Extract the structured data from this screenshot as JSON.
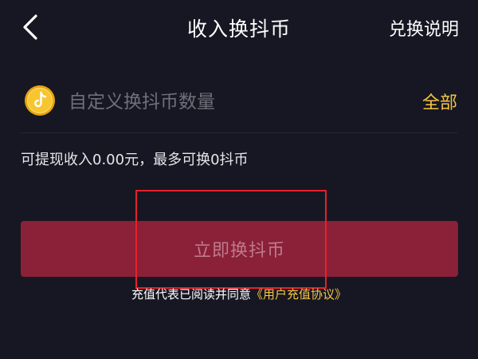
{
  "header": {
    "title": "收入换抖币",
    "explain_label": "兑换说明"
  },
  "amount": {
    "placeholder": "自定义换抖币数量",
    "value": "",
    "all_label": "全部"
  },
  "info": {
    "text": "可提现收入0.00元，最多可换0抖币"
  },
  "exchange_button": {
    "label": "立即换抖币"
  },
  "agreement": {
    "prefix": "充值代表已阅读并同意",
    "link": "《用户充值协议》"
  },
  "colors": {
    "background": "#161722",
    "accent_gold": "#f6c544",
    "button_bg": "#8a2139",
    "highlight": "#e8202a"
  },
  "icons": {
    "back": "chevron-left-icon",
    "coin": "douyin-coin-icon"
  }
}
